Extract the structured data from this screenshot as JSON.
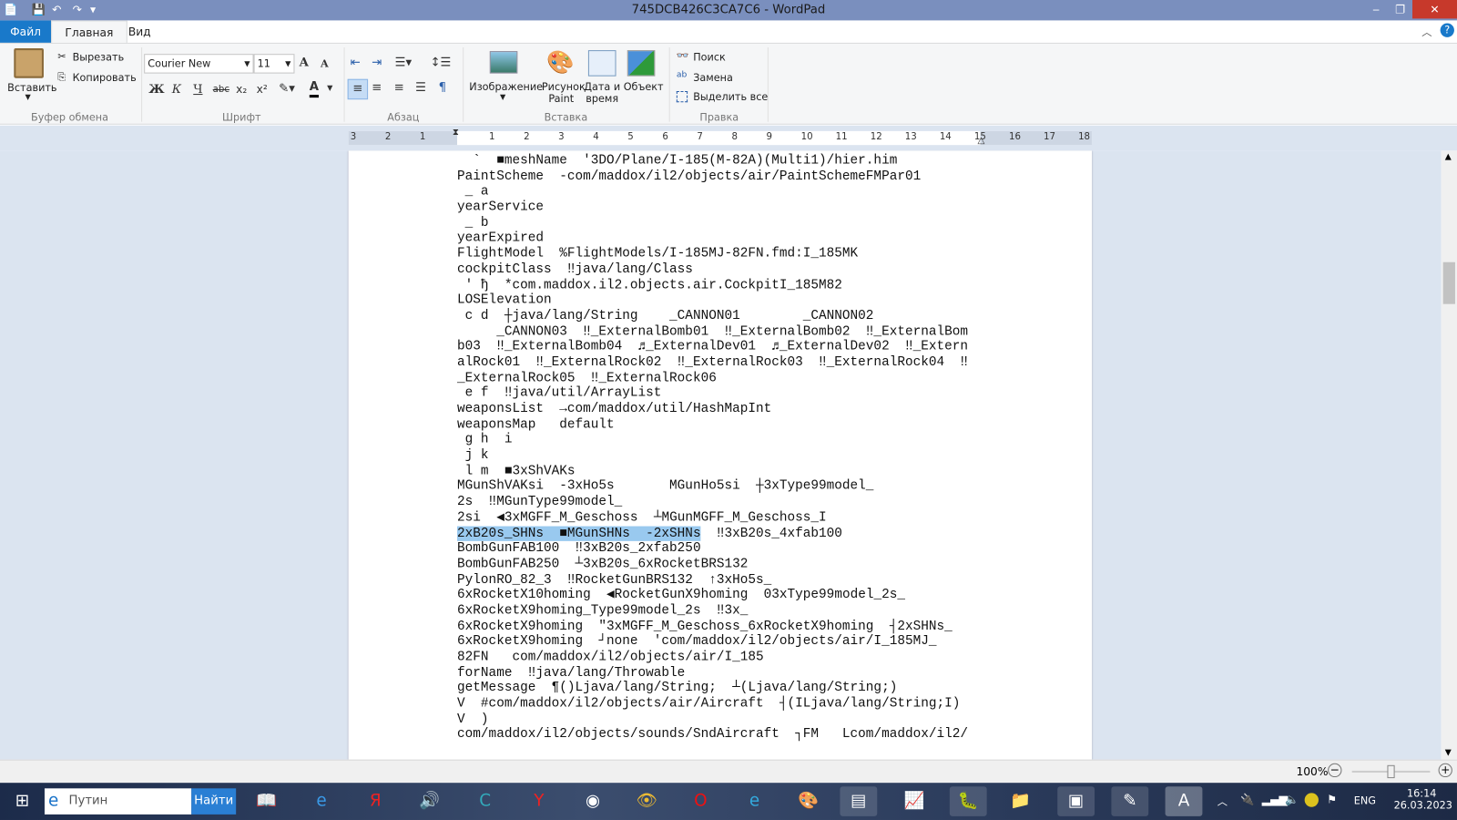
{
  "window": {
    "title": "745DCB426C3CA7C6 - WordPad",
    "minimize": "‒",
    "maximize": "❐",
    "close": "✕"
  },
  "quick_access": {
    "save": "💾",
    "undo": "↶",
    "redo": "↷",
    "customize": "▾"
  },
  "tabs": [
    {
      "label": "Файл"
    },
    {
      "label": "Главная"
    },
    {
      "label": "Вид"
    }
  ],
  "ribbon": {
    "clipboard": {
      "paste": "Вставить",
      "cut": "Вырезать",
      "copy": "Копировать",
      "label": "Буфер обмена"
    },
    "font": {
      "family": "Courier New",
      "size": "11",
      "grow": "A",
      "shrink": "A",
      "bold": "Ж",
      "italic": "К",
      "underline": "Ч",
      "strike": "abc",
      "subscript": "x₂",
      "superscript": "x²",
      "label": "Шрифт"
    },
    "paragraph": {
      "label": "Абзац"
    },
    "insert": {
      "image": "Изображение",
      "paint": "Рисунок Paint",
      "datetime": "Дата и время",
      "object": "Объект",
      "label": "Вставка"
    },
    "editing": {
      "find": "Поиск",
      "replace": "Замена",
      "select_all": "Выделить все",
      "label": "Правка"
    }
  },
  "ruler": {
    "left_ticks": [
      "3",
      "2",
      "1"
    ],
    "right_ticks": [
      "1",
      "2",
      "3",
      "4",
      "5",
      "6",
      "7",
      "8",
      "9",
      "10",
      "11",
      "12",
      "13",
      "14",
      "15",
      "16",
      "17",
      "18"
    ]
  },
  "document": {
    "lines": [
      "  `  ■meshName  '3DO/Plane/I-185(M-82A)(Multi1)/hier.him",
      "PaintScheme  -com/maddox/il2/objects/air/PaintSchemeFMPar01",
      " _ a",
      "yearService",
      " _ b",
      "yearExpired",
      "FlightModel  %FlightModels/I-185MJ-82FN.fmd:I_185MK",
      "cockpitClass  ‼java/lang/Class",
      " ' ђ  *com.maddox.il2.objects.air.CockpitI_185M82",
      "LOSElevation",
      " c d  ┼java/lang/String    _CANNON01        _CANNON02",
      "     _CANNON03  ‼_ExternalBomb01  ‼_ExternalBomb02  ‼_ExternalBom",
      "b03  ‼_ExternalBomb04  ♬_ExternalDev01  ♬_ExternalDev02  ‼_Extern",
      "alRock01  ‼_ExternalRock02  ‼_ExternalRock03  ‼_ExternalRock04  ‼",
      "_ExternalRock05  ‼_ExternalRock06",
      " e f  ‼java/util/ArrayList",
      "weaponsList  →com/maddox/util/HashMapInt",
      "weaponsMap   default",
      " g h  i",
      " j k",
      " l m  ■3xShVAKs",
      "MGunShVAKsi  -3xHo5s       MGunHo5si  ┼3xType99model_",
      "2s  ‼MGunType99model_",
      "2si  ◀3xMGFF_M_Geschoss  ┴MGunMGFF_M_Geschoss_I",
      {
        "hl": "2xB20s_SHNs  ■MGunSHNs  -2xSHNs",
        "rest": "  ‼3xB20s_4xfab100"
      },
      "BombGunFAB100  ‼3xB20s_2xfab250",
      "BombGunFAB250  ┴3xB20s_6xRocketBRS132",
      "PylonRO_82_3  ‼RocketGunBRS132  ↑3xHo5s_",
      "6xRocketX10homing  ◀RocketGunX9homing  03xType99model_2s_",
      "6xRocketX9homing_Type99model_2s  ‼3x_",
      "6xRocketX9homing  \"3xMGFF_M_Geschoss_6xRocketX9homing  ┤2xSHNs_",
      "6xRocketX9homing  ┘none  'com/maddox/il2/objects/air/I_185MJ_",
      "82FN   com/maddox/il2/objects/air/I_185",
      "forName  ‼java/lang/Throwable",
      "getMessage  ¶()Ljava/lang/String;  ┴(Ljava/lang/String;)",
      "V  #com/maddox/il2/objects/air/Aircraft  ┤(ILjava/lang/String;I)",
      "V  )",
      "com/maddox/il2/objects/sounds/SndAircraft  ┐FM   Lcom/maddox/il2/"
    ]
  },
  "status": {
    "zoom": "100%",
    "zoom_level": 100
  },
  "taskbar": {
    "search_value": "Путин",
    "search_button": "Найти",
    "lang": "ENG",
    "time": "16:14",
    "date": "26.03.2023"
  },
  "colors": {
    "title_bar": "#7a8fbe",
    "file_tab": "#1979ca",
    "selection": "#99c9ef"
  }
}
